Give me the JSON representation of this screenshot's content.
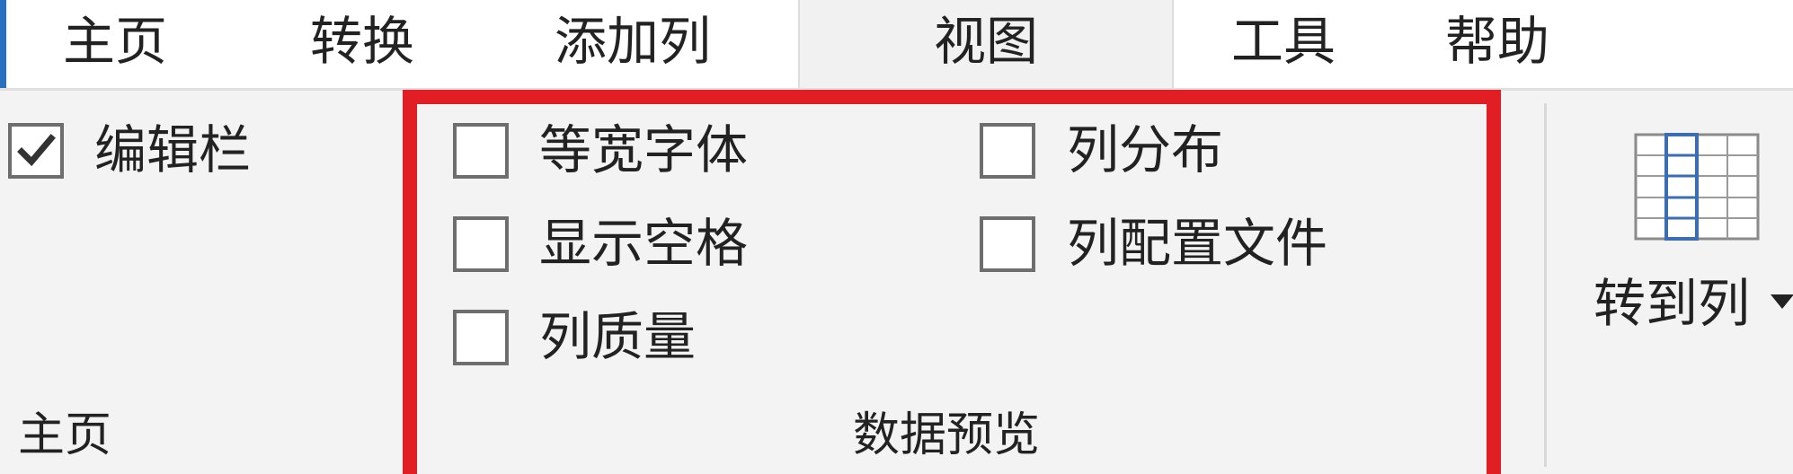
{
  "tabs": [
    {
      "label": "主页"
    },
    {
      "label": "转换"
    },
    {
      "label": "添加列"
    },
    {
      "label": "视图",
      "active": true
    },
    {
      "label": "工具"
    },
    {
      "label": "帮助"
    }
  ],
  "layout_group": {
    "formula_bar": {
      "label": "编辑栏",
      "checked": true
    },
    "group_label": "主页"
  },
  "data_preview_group": {
    "options": [
      {
        "label": "等宽字体",
        "checked": false
      },
      {
        "label": "显示空格",
        "checked": false
      },
      {
        "label": "列质量",
        "checked": false
      },
      {
        "label": "列分布",
        "checked": false
      },
      {
        "label": "列配置文件",
        "checked": false
      }
    ],
    "group_label": "数据预览"
  },
  "columns_group": {
    "goto_column_label": "转到列"
  },
  "colors": {
    "accent": "#2b6fc0",
    "highlight_border": "#e01e24",
    "grid_icon_blue": "#3a6db5"
  },
  "icons": {
    "checkmark": "check-icon",
    "goto_column": "table-column-icon",
    "dropdown": "dropdown-arrow-icon"
  }
}
